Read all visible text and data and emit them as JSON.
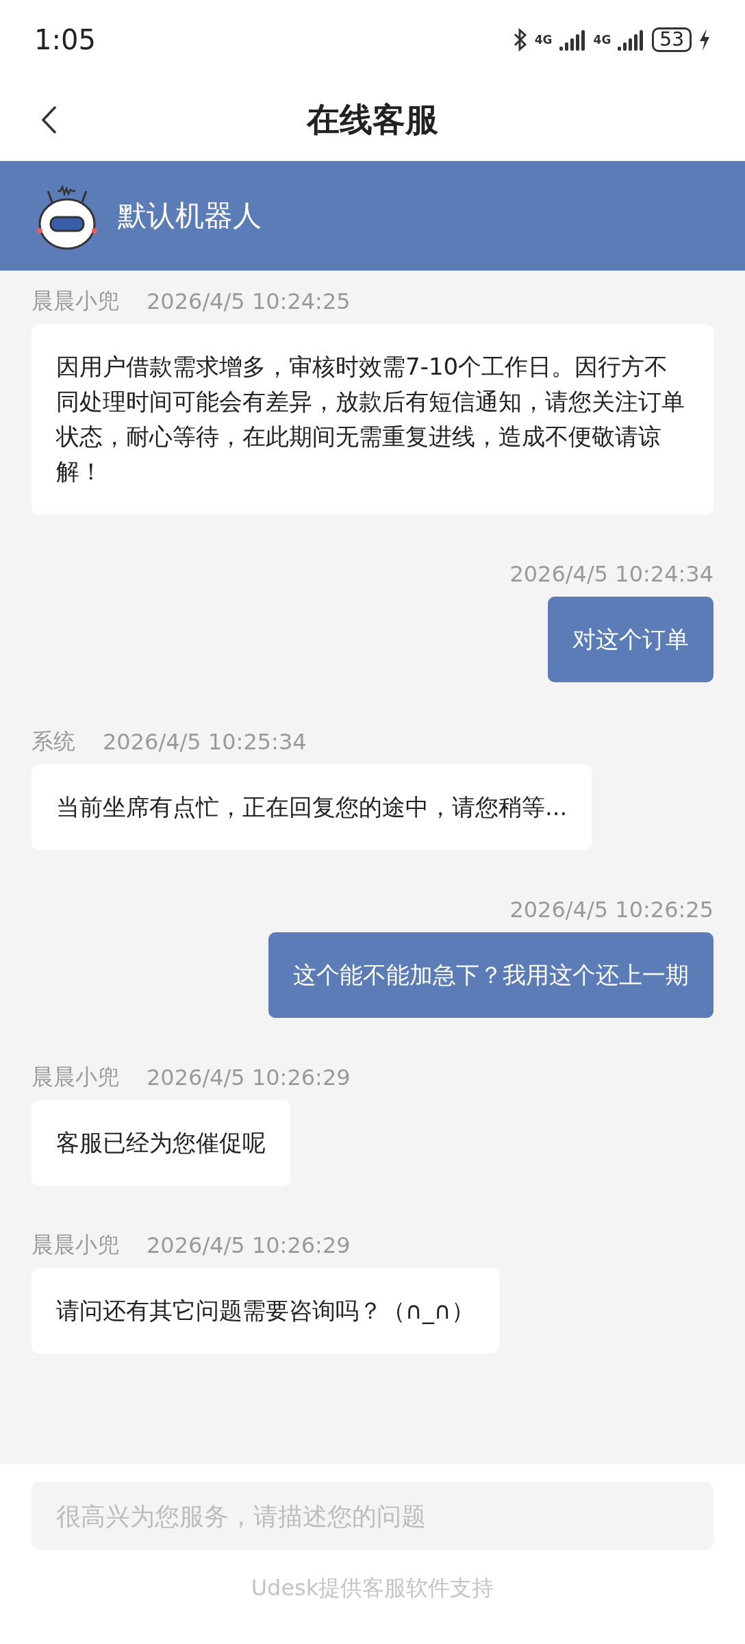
{
  "status_bar": {
    "time": "1:05",
    "networks": [
      "4G",
      "4G"
    ],
    "battery": "53"
  },
  "nav": {
    "title": "在线客服"
  },
  "agent": {
    "name": "默认机器人"
  },
  "messages": [
    {
      "kind": "incoming",
      "sender": "晨晨小兜",
      "time": "2026/4/5 10:24:25",
      "text": "因用户借款需求增多，审核时效需7-10个工作日。因行方不同处理时间可能会有差异，放款后有短信通知，请您关注订单状态，耐心等待，在此期间无需重复进线，造成不便敬请谅解！"
    },
    {
      "kind": "outgoing",
      "time": "2026/4/5 10:24:34",
      "text": "对这个订单"
    },
    {
      "kind": "incoming",
      "sender": "系统",
      "time": "2026/4/5 10:25:34",
      "text": "当前坐席有点忙，正在回复您的途中，请您稍等..."
    },
    {
      "kind": "outgoing",
      "time": "2026/4/5 10:26:25",
      "text": "这个能不能加急下？我用这个还上一期"
    },
    {
      "kind": "incoming",
      "sender": "晨晨小兜",
      "time": "2026/4/5 10:26:29",
      "text": "客服已经为您催促呢"
    },
    {
      "kind": "incoming",
      "sender": "晨晨小兜",
      "time": "2026/4/5 10:26:29",
      "text": "请问还有其它问题需要咨询吗？（∩_∩）"
    }
  ],
  "composer": {
    "placeholder": "很高兴为您服务，请描述您的问题"
  },
  "footer": "Udesk提供客服软件支持"
}
